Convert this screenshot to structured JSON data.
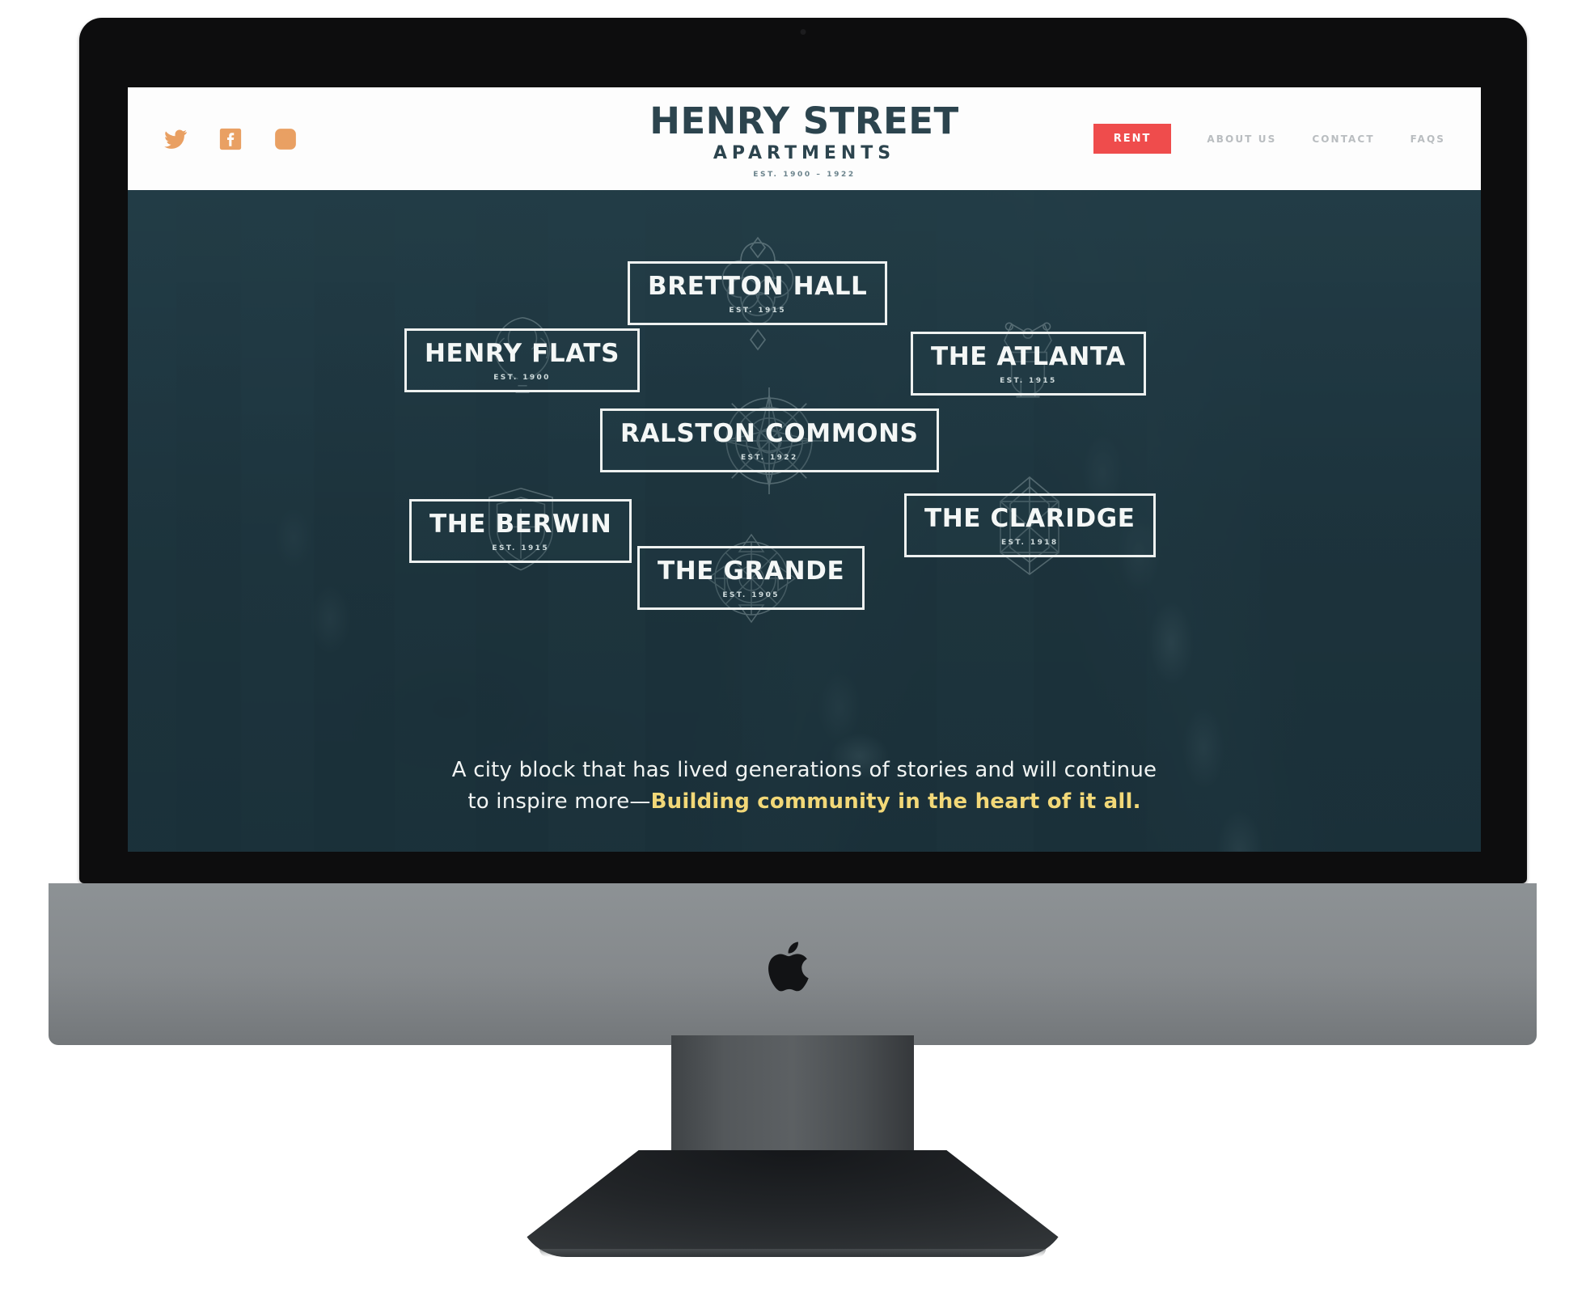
{
  "brand": {
    "logo_main": "HENRY STREET",
    "logo_sub": "APARTMENTS",
    "logo_est": "EST. 1900 – 1922",
    "accent_red": "#ef4c4c",
    "accent_orange": "#e9a063",
    "accent_yellow": "#f2d878",
    "ink_teal": "#2c444e",
    "hero_overlay": "#2a4954"
  },
  "header": {
    "social": [
      {
        "name": "twitter-icon",
        "label": "Twitter"
      },
      {
        "name": "facebook-icon",
        "label": "Facebook"
      },
      {
        "name": "instagram-icon",
        "label": "Instagram"
      }
    ],
    "nav": {
      "rent_label": "RENT",
      "links": [
        {
          "label": "ABOUT US"
        },
        {
          "label": "CONTACT"
        },
        {
          "label": "FAQS"
        }
      ]
    }
  },
  "hero": {
    "buildings": [
      {
        "name": "BRETTON HALL",
        "est": "EST. 1915",
        "crest": "quatrefoil"
      },
      {
        "name": "HENRY FLATS",
        "est": "EST. 1900",
        "crest": "wreath"
      },
      {
        "name": "THE ATLANTA",
        "est": "EST. 1915",
        "crest": "crown"
      },
      {
        "name": "RALSTON COMMONS",
        "est": "EST. 1922",
        "crest": "compass"
      },
      {
        "name": "THE BERWIN",
        "est": "EST. 1915",
        "crest": "shield"
      },
      {
        "name": "THE CLARIDGE",
        "est": "EST. 1918",
        "crest": "lantern"
      },
      {
        "name": "THE GRANDE",
        "est": "EST. 1905",
        "crest": "rosette"
      }
    ],
    "tagline_lead": "A city block that has lived generations of stories and will continue to inspire more—",
    "tagline_accent": "Building community in the heart of it all."
  },
  "device": {
    "brand_mark": "apple-logo"
  }
}
